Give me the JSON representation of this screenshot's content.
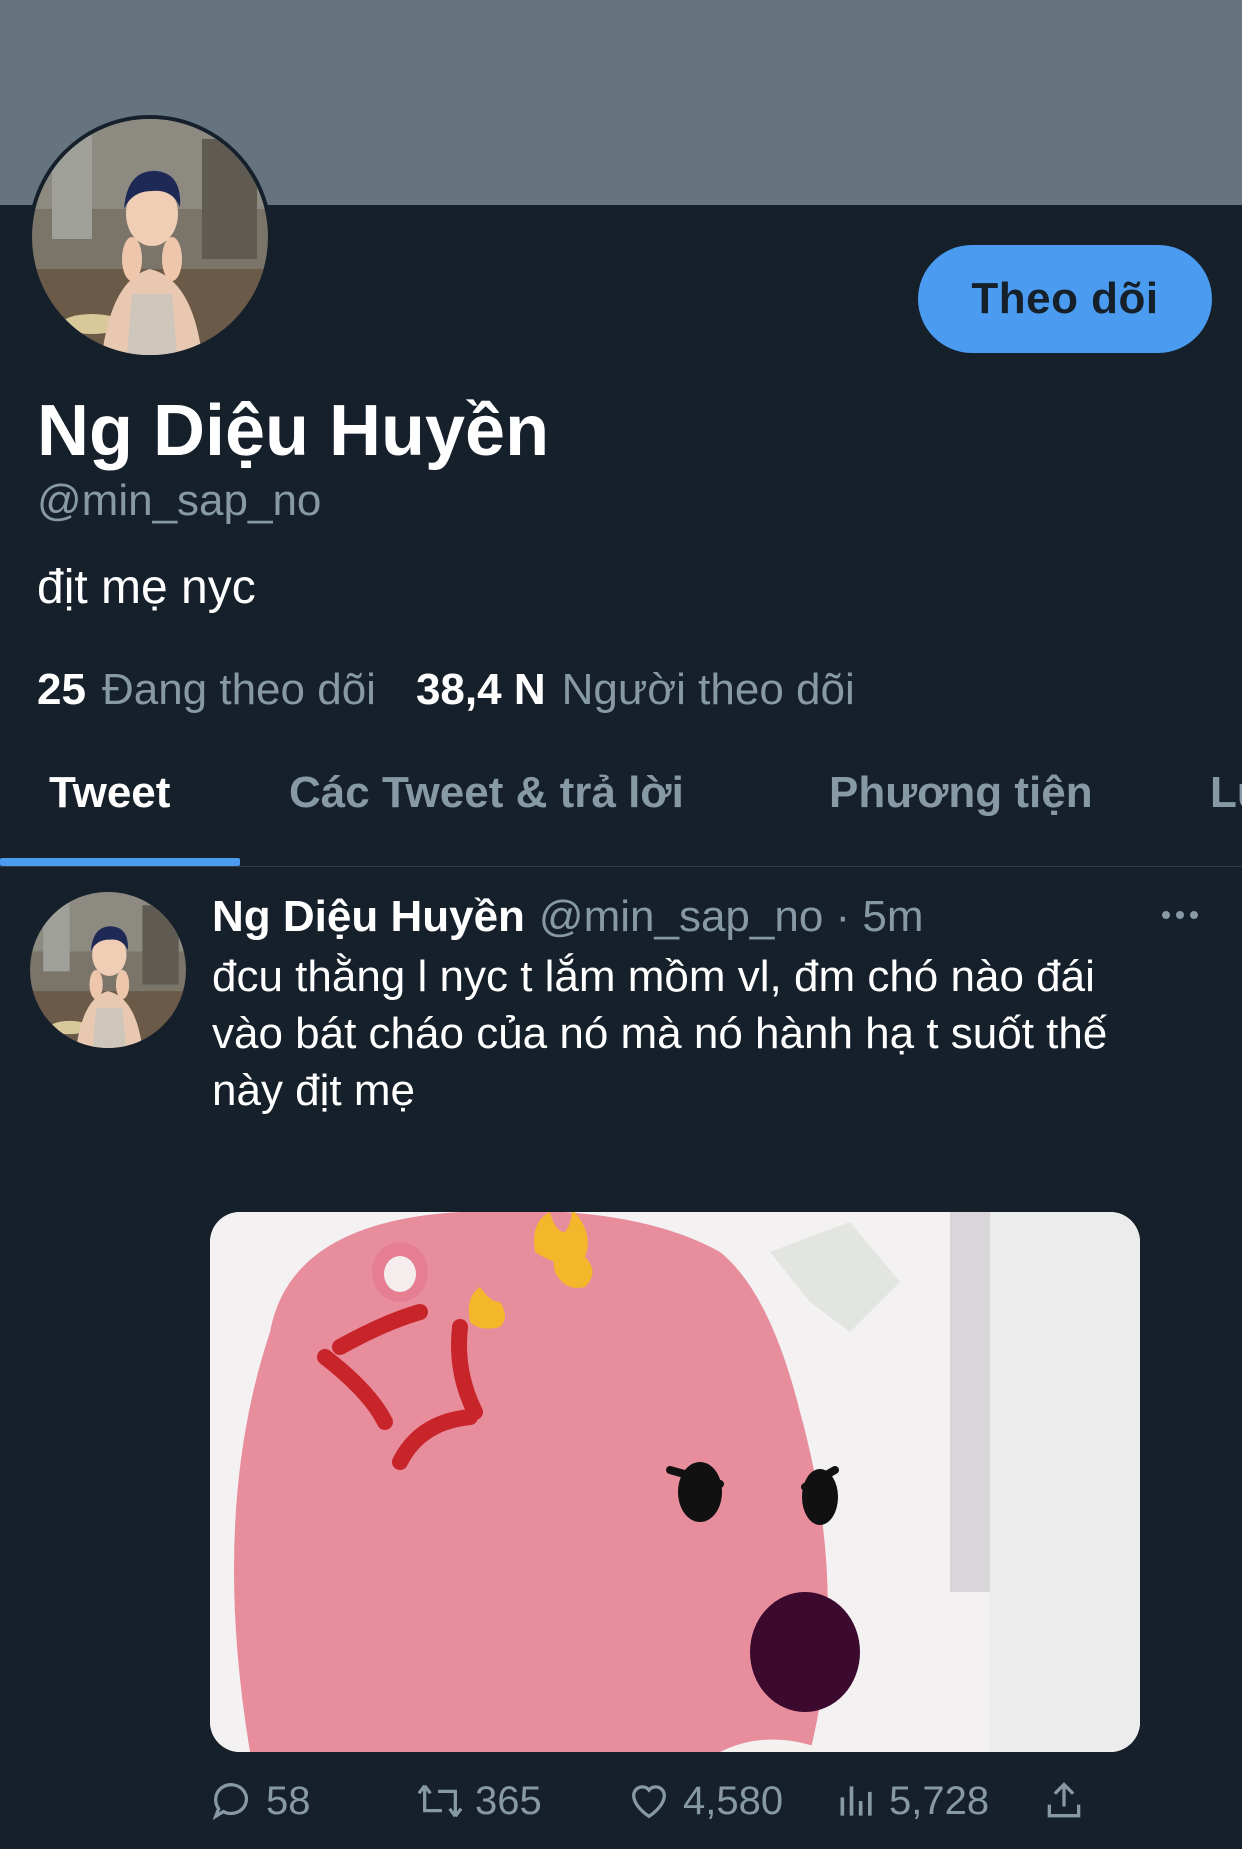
{
  "profile": {
    "display_name": "Ng Diệu Huyền",
    "handle": "@min_sap_no",
    "bio": "địt mẹ nyc",
    "follow_label": "Theo dõi",
    "following_count": "25",
    "following_label": "Đang theo dõi",
    "followers_count": "38,4 N",
    "followers_label": "Người theo dõi"
  },
  "tabs": [
    {
      "label": "Tweet",
      "active": true
    },
    {
      "label": "Các Tweet & trả lời",
      "active": false
    },
    {
      "label": "Phương tiện",
      "active": false
    },
    {
      "label": "Lu",
      "active": false
    }
  ],
  "tweet": {
    "name": "Ng Diệu Huyền",
    "handle_time": "@min_sap_no · 5m",
    "text": "đcu thằng l nyc t lắm mồm vl, đm chó nào đái vào bát cháo của nó mà nó hành hạ t suốt thế này địt mẹ",
    "replies": "58",
    "retweets": "365",
    "likes": "4,580",
    "views": "5,728"
  },
  "colors": {
    "background": "#15202b",
    "banner": "#66747f",
    "accent": "#4b9cf0",
    "secondary_text": "#8899a6"
  },
  "icons": [
    "more-icon",
    "reply-icon",
    "retweet-icon",
    "like-icon",
    "views-icon",
    "share-icon"
  ]
}
